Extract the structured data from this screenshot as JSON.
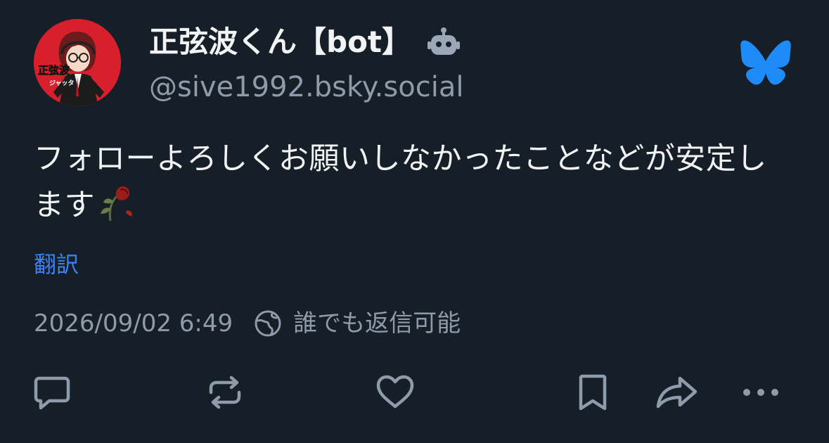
{
  "author": {
    "display_name": "正弦波くん【bot】",
    "handle": "@sive1992.bsky.social",
    "avatar_icon": "avatar-illustration",
    "avatar_text": "正弦波",
    "avatar_subtext": "ジャッタ"
  },
  "post": {
    "text": "フォローよろしくお願いしなかったことなどが安定します",
    "emoji": "wilted-flower-icon",
    "translate_label": "翻訳",
    "timestamp": "2026/09/02 6:49",
    "reply_setting": "誰でも返信可能"
  },
  "icons": {
    "bot": "robot-icon",
    "app": "bluesky-butterfly-icon",
    "globe": "globe-icon",
    "reply": "reply-icon",
    "repost": "repost-icon",
    "like": "heart-icon",
    "bookmark": "bookmark-icon",
    "share": "share-icon",
    "more": "more-icon"
  },
  "colors": {
    "background": "#161e27",
    "text": "#f1f3f5",
    "muted": "#8e9bab",
    "accent": "#3b82f6",
    "avatar_bg": "#d8202c"
  }
}
